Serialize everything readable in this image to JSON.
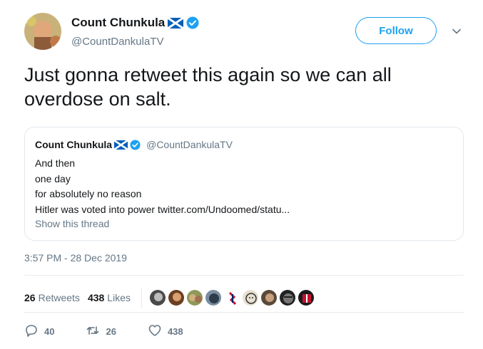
{
  "author": {
    "display_name": "Count Chunkula",
    "handle": "@CountDankulaTV",
    "avatar_icon": "avatar-image",
    "flag_icon": "scotland-flag-icon",
    "verified_icon": "verified-badge-icon"
  },
  "follow_label": "Follow",
  "tweet_text": "Just gonna retweet this again so we can all overdose on salt.",
  "quoted": {
    "display_name": "Count Chunkula",
    "handle": "@CountDankulaTV",
    "lines": [
      "And then",
      "one day",
      "for absolutely no reason",
      "Hitler was voted into power twitter.com/Undoomed/statu..."
    ],
    "show_thread": "Show this thread"
  },
  "timestamp": "3:57 PM - 28 Dec 2019",
  "stats": {
    "retweets_count": "26",
    "retweets_label": "Retweets",
    "likes_count": "438",
    "likes_label": "Likes"
  },
  "likers_count_shown": 9,
  "actions": {
    "replies": "40",
    "retweets": "26",
    "likes": "438"
  },
  "colors": {
    "accent": "#1da1f2",
    "secondary_text": "#657786",
    "border": "#e1e8ed"
  }
}
